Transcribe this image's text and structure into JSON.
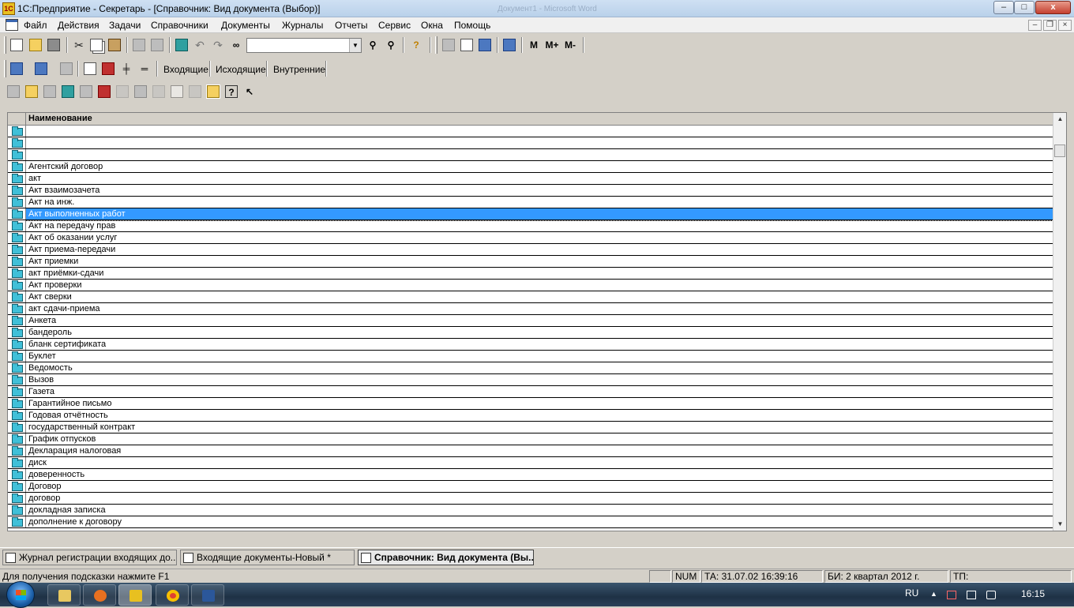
{
  "window": {
    "title": "1С:Предприятие - Секретарь - [Справочник: Вид документа (Выбор)]",
    "background_title": "Документ1 - Microsoft Word",
    "minimize": "–",
    "maximize": "□",
    "close": "x"
  },
  "menu": {
    "items": [
      "Файл",
      "Действия",
      "Задачи",
      "Справочники",
      "Документы",
      "Журналы",
      "Отчеты",
      "Сервис",
      "Окна",
      "Помощь"
    ],
    "mdi_minimize": "–",
    "mdi_restore": "❐",
    "mdi_close": "×"
  },
  "toolbar1": {
    "combo_value": "",
    "mem_buttons": [
      "M",
      "M+",
      "M-"
    ]
  },
  "toolbar2": {
    "text_buttons": [
      "Входящие",
      "Исходящие",
      "Внутренние"
    ]
  },
  "list": {
    "column_header": "Наименование",
    "selected_index": 7,
    "rows": [
      "",
      "",
      "",
      "Агентский договор",
      "акт",
      "Акт взаимозачета",
      "Акт на инж.",
      "Акт выполненных работ",
      "Акт на передачу прав",
      "Акт об оказании услуг",
      "Акт приема-передачи",
      "Акт приемки",
      "акт приёмки-сдачи",
      "Акт проверки",
      "Акт сверки",
      "акт сдачи-приема",
      "Анкета",
      "бандероль",
      "бланк сертификата",
      "Буклет",
      "Ведомость",
      "Вызов",
      "Газета",
      "Гарантийное письмо",
      "Годовая отчётность",
      "государственный контракт",
      "График отпусков",
      "Декларация налоговая",
      "диск",
      "доверенность",
      "Договор",
      "договор",
      "докладная записка",
      "дополнение к договору"
    ]
  },
  "window_tabs": [
    "Журнал регистрации входящих до...",
    "Входящие документы-Новый *",
    "Справочник: Вид документа (Вы..."
  ],
  "statusbar": {
    "hint": "Для получения подсказки нажмите F1",
    "num": "NUM",
    "ta": "ТА: 31.07.02  16:39:16",
    "bi": "БИ: 2 квартал 2012 г.",
    "tp": "ТП:"
  },
  "taskbar": {
    "lang": "RU",
    "clock": "16:15",
    "apps": [
      "explorer",
      "firefox",
      "1c-enterprise",
      "chrome",
      "word"
    ]
  },
  "icons": {
    "row_icon": "folder-icon",
    "toolbar1": [
      "new-doc-icon",
      "open-folder-icon",
      "save-icon",
      "cut-icon",
      "copy-icon",
      "paste-icon",
      "print-icon",
      "print-preview-icon",
      "find-icon",
      "undo-icon",
      "redo-icon",
      "binoculars-icon",
      "search-next-icon",
      "search-prev-icon",
      "help-icon",
      "calculator-icon",
      "calendar-icon",
      "magic-wand-icon",
      "book-icon"
    ],
    "toolbar2": [
      "journal-icon",
      "card-icon",
      "register-icon",
      "columns-icon",
      "red-book-icon",
      "add-line-icon",
      "remove-line-icon"
    ],
    "toolbar3": [
      "list-icon",
      "folder-icon",
      "edit-icon",
      "find-in-list-icon",
      "filter-icon",
      "delete-icon",
      "copy-row-icon",
      "edit-row-icon",
      "copy-doc-icon",
      "doc-icon",
      "move-doc-icon",
      "tree-icon",
      "help-icon",
      "cursor-help-icon"
    ]
  },
  "colors": {
    "selection": "#3399ff",
    "folder": "#40c0d8"
  }
}
